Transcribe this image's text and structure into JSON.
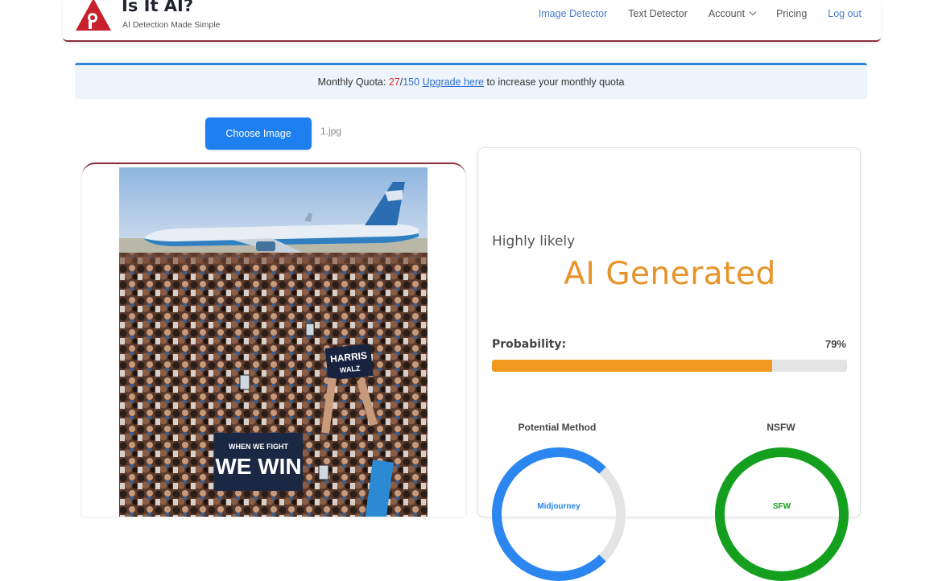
{
  "header": {
    "brand_title": "Is It AI?",
    "brand_subtitle": "AI Detection Made Simple",
    "nav": {
      "image_detector": "Image Detector",
      "text_detector": "Text Detector",
      "account": "Account",
      "pricing": "Pricing",
      "logout": "Log out"
    }
  },
  "quota": {
    "prefix": "Monthly Quota: ",
    "used": "27",
    "separator": "/",
    "total": "150",
    "upgrade_link": "Upgrade here",
    "suffix": " to increase your monthly quota"
  },
  "upload": {
    "button_label": "Choose Image",
    "file_name": "1.jpg"
  },
  "result": {
    "qualifier": "Highly likely",
    "verdict": "AI Generated",
    "probability_label": "Probability:",
    "probability_value": "79%",
    "probability_fraction": 0.79,
    "method_label": "Potential Method",
    "method_value": "Midjourney",
    "nsfw_label": "NSFW",
    "nsfw_value": "SFW"
  },
  "image_text": {
    "sign_1_line_1": "HARRIS",
    "sign_1_line_2": "WALZ",
    "sign_2_line_1": "WHEN WE FIGHT",
    "sign_2_line_2": "WE WIN"
  },
  "colors": {
    "accent_blue": "#1e7ff0",
    "verdict_orange": "#e8932a",
    "probability_fill": "#f29a1f",
    "method_ring": "#2b86f0",
    "nsfw_ring": "#14a01e",
    "header_border": "#8b2c3a"
  },
  "icons": {
    "logo": "red-triangle-a-logo",
    "account_caret": "chevron-down-icon"
  }
}
